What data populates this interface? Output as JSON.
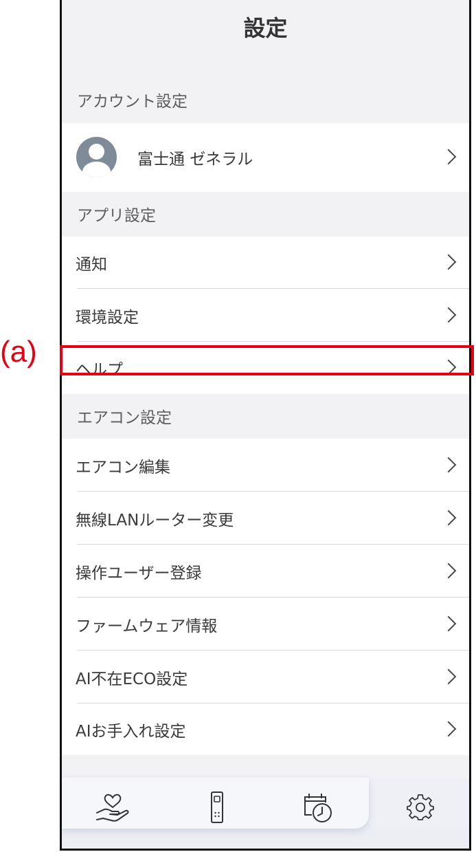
{
  "annotation": {
    "label": "(a)"
  },
  "header": {
    "title": "設定"
  },
  "sections": {
    "account": "アカウント設定",
    "app": "アプリ設定",
    "aircon": "エアコン設定"
  },
  "account": {
    "name": "富士通 ゼネラル"
  },
  "app_items": [
    "通知",
    "環境設定",
    "ヘルプ"
  ],
  "aircon_items": [
    "エアコン編集",
    "無線LANルーター変更",
    "操作ユーザー登録",
    "ファームウェア情報",
    "AI不在ECO設定",
    "AIお手入れ設定"
  ],
  "tabs": [
    {
      "icon": "heart-hand-icon"
    },
    {
      "icon": "remote-control-icon"
    },
    {
      "icon": "calendar-clock-icon"
    },
    {
      "icon": "gear-icon",
      "active": true
    }
  ],
  "colors": {
    "annotation": "#e60012",
    "background": "#f2f2f4",
    "text": "#3a3a3a"
  }
}
